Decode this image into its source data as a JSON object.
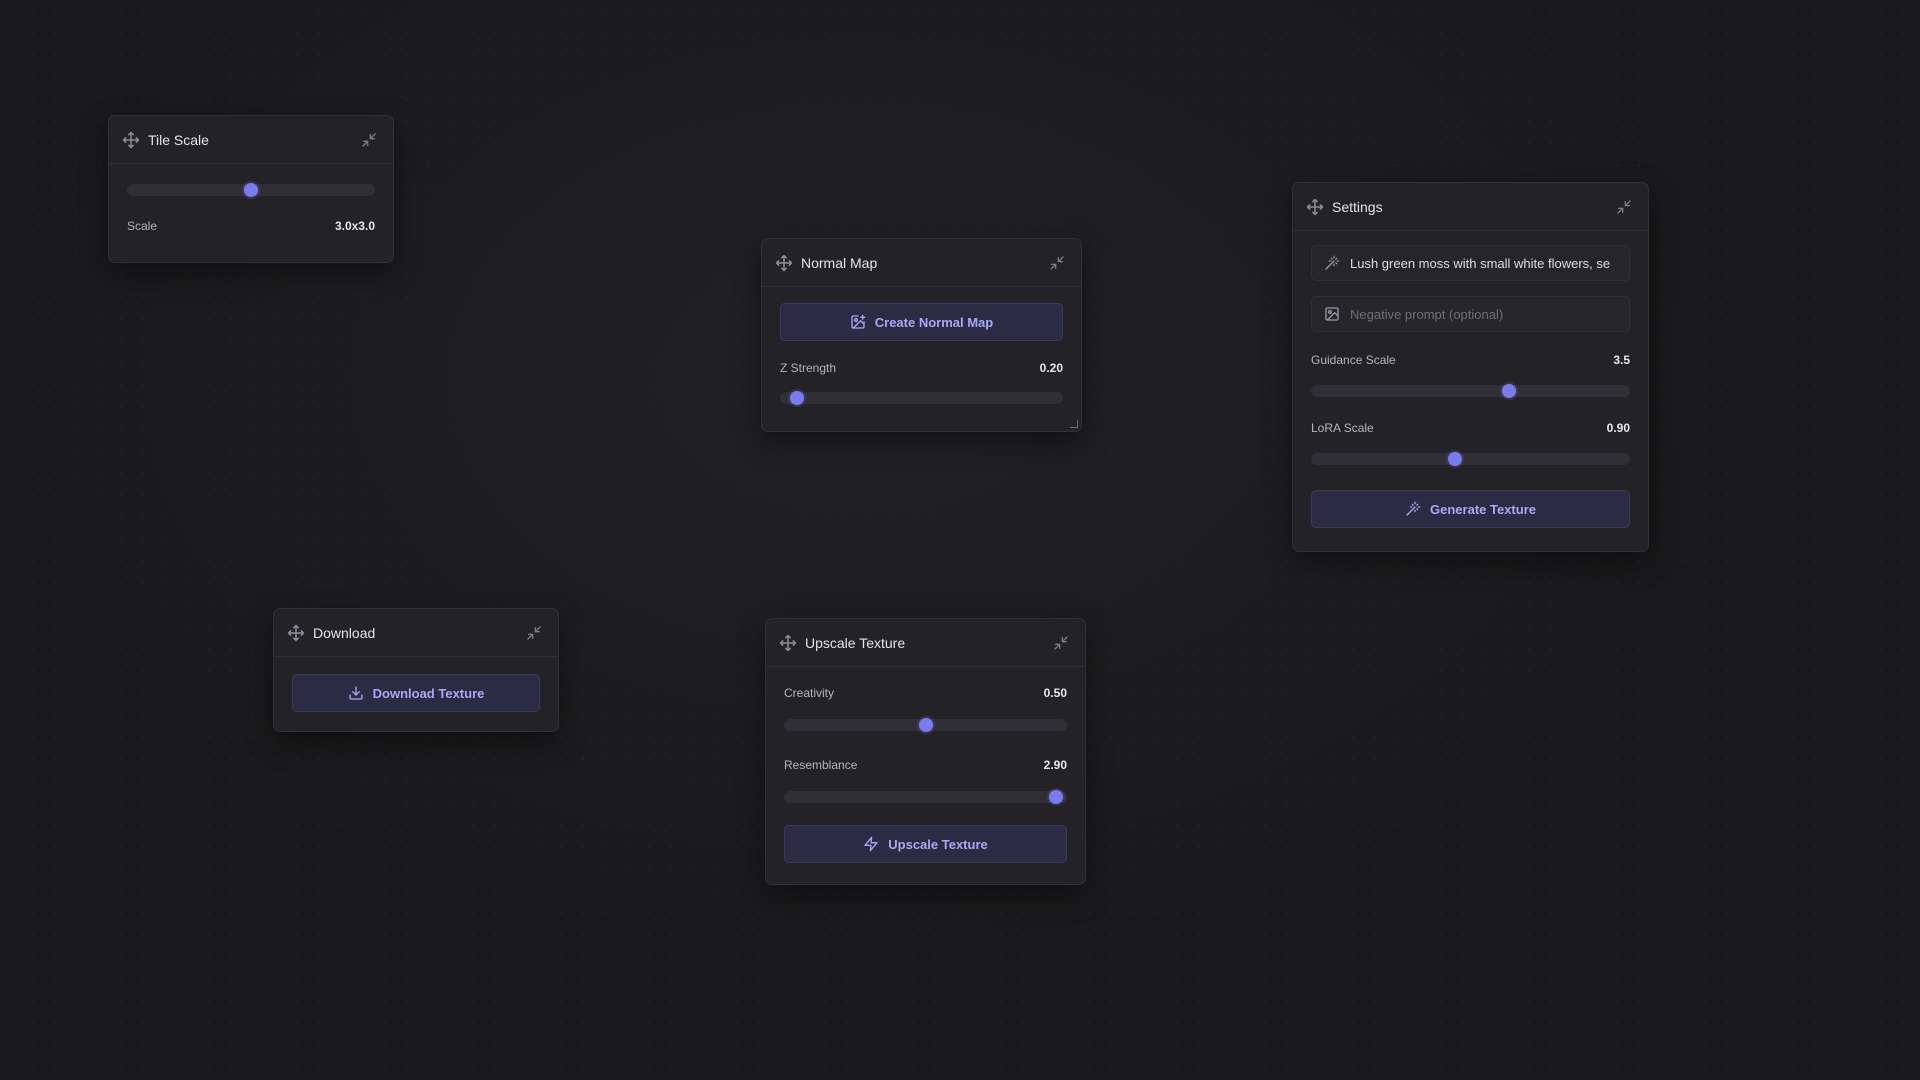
{
  "tile_scale": {
    "title": "Tile Scale",
    "slider_value": 0.5,
    "label": "Scale",
    "value_text": "3.0x3.0"
  },
  "normal_map": {
    "title": "Normal Map",
    "button_label": "Create Normal Map",
    "z_strength": {
      "label": "Z Strength",
      "value_text": "0.20",
      "value": 0.06
    }
  },
  "settings": {
    "title": "Settings",
    "prompt_value": "Lush green moss with small white flowers, se",
    "negative_placeholder": "Negative prompt (optional)",
    "guidance": {
      "label": "Guidance Scale",
      "value_text": "3.5",
      "value": 0.62
    },
    "lora": {
      "label": "LoRA Scale",
      "value_text": "0.90",
      "value": 0.45
    },
    "button_label": "Generate Texture"
  },
  "download": {
    "title": "Download",
    "button_label": "Download Texture"
  },
  "upscale": {
    "title": "Upscale Texture",
    "creativity": {
      "label": "Creativity",
      "value_text": "0.50",
      "value": 0.5
    },
    "resemblance": {
      "label": "Resemblance",
      "value_text": "2.90",
      "value": 0.96
    },
    "button_label": "Upscale Texture"
  },
  "colors": {
    "background": "#19191b",
    "panel": "#232327",
    "accent": "#7b7bf0",
    "button_bg": "#2c2b44",
    "button_text": "#a9a8f4"
  },
  "icons": {
    "drag": "move-icon",
    "collapse": "minimize-icon",
    "create_normal_map": "image-plus-icon",
    "prompt": "wand-icon",
    "negative_prompt": "image-icon",
    "generate": "wand-icon",
    "download": "download-icon",
    "upscale": "zap-icon"
  }
}
